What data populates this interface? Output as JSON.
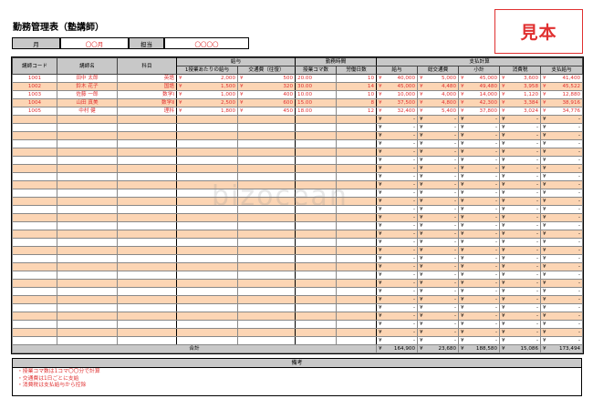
{
  "title": "勤務管理表（塾講師）",
  "stamp": "見本",
  "watermark": "bizocean",
  "info": {
    "month_label": "月",
    "month_value": "〇〇月",
    "manager_label": "担当",
    "manager_value": "〇〇〇〇"
  },
  "headers": {
    "id": "講師コード",
    "name": "講師名",
    "subject": "科目",
    "pay_group": "給与",
    "rate": "1授業あたりの給与",
    "transport": "交通費（往復）",
    "hours_group": "勤務時間",
    "lessons": "授業コマ数",
    "days": "労働日数",
    "payment_group": "支払計算",
    "salary": "給与",
    "total_transport": "総交通費",
    "subtotal": "小計",
    "tax": "消費税",
    "payment": "支払給与"
  },
  "yen": "¥",
  "dash": "-",
  "rows": [
    {
      "id": "1001",
      "name": "田中 太郎",
      "subject": "英語",
      "rate": "2,000",
      "transport": "500",
      "lessons": "20.00",
      "days": "10",
      "salary": "40,000",
      "total_transport": "5,000",
      "subtotal": "45,000",
      "tax": "3,600",
      "payment": "41,400"
    },
    {
      "id": "1002",
      "name": "鈴木 花子",
      "subject": "国語",
      "rate": "1,500",
      "transport": "320",
      "lessons": "30.00",
      "days": "14",
      "salary": "45,000",
      "total_transport": "4,480",
      "subtotal": "49,480",
      "tax": "3,958",
      "payment": "45,522"
    },
    {
      "id": "1003",
      "name": "佐藤 一郎",
      "subject": "数学Ⅰ",
      "rate": "1,000",
      "transport": "400",
      "lessons": "10.00",
      "days": "10",
      "salary": "10,000",
      "total_transport": "4,000",
      "subtotal": "14,000",
      "tax": "1,120",
      "payment": "12,880"
    },
    {
      "id": "1004",
      "name": "山田 真美",
      "subject": "数学Ⅱ",
      "rate": "2,500",
      "transport": "600",
      "lessons": "15.00",
      "days": "8",
      "salary": "37,500",
      "total_transport": "4,800",
      "subtotal": "42,300",
      "tax": "3,384",
      "payment": "38,916"
    },
    {
      "id": "1005",
      "name": "中村 健",
      "subject": "理科",
      "rate": "1,800",
      "transport": "450",
      "lessons": "18.00",
      "days": "12",
      "salary": "32,400",
      "total_transport": "5,400",
      "subtotal": "37,800",
      "tax": "3,024",
      "payment": "34,776"
    }
  ],
  "empty_rows": 28,
  "total": {
    "label": "合計",
    "salary": "164,900",
    "total_transport": "23,680",
    "subtotal": "188,580",
    "tax": "15,086",
    "payment": "173,494"
  },
  "remarks": {
    "header": "備考",
    "lines": [
      "・授業コマ数は1コマ〇〇分で計算",
      "・交通費は1日ごとに支給",
      "・消費税は支払給与から控除"
    ]
  }
}
